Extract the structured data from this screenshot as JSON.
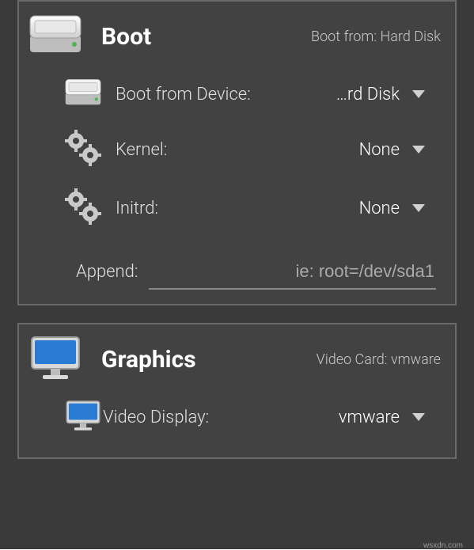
{
  "boot": {
    "title": "Boot",
    "summary_label": "Boot from:",
    "summary_value": "Hard Disk",
    "device": {
      "label": "Boot from Device:",
      "value": "…rd Disk"
    },
    "kernel": {
      "label": "Kernel:",
      "value": "None"
    },
    "initrd": {
      "label": "Initrd:",
      "value": "None"
    },
    "append": {
      "label": "Append:",
      "placeholder": "ie: root=/dev/sda1",
      "value": ""
    }
  },
  "graphics": {
    "title": "Graphics",
    "summary_label": "Video Card:",
    "summary_value": "vmware",
    "display": {
      "label": "Video Display:",
      "value": "vmware"
    }
  },
  "watermark": "wsxdn.com"
}
